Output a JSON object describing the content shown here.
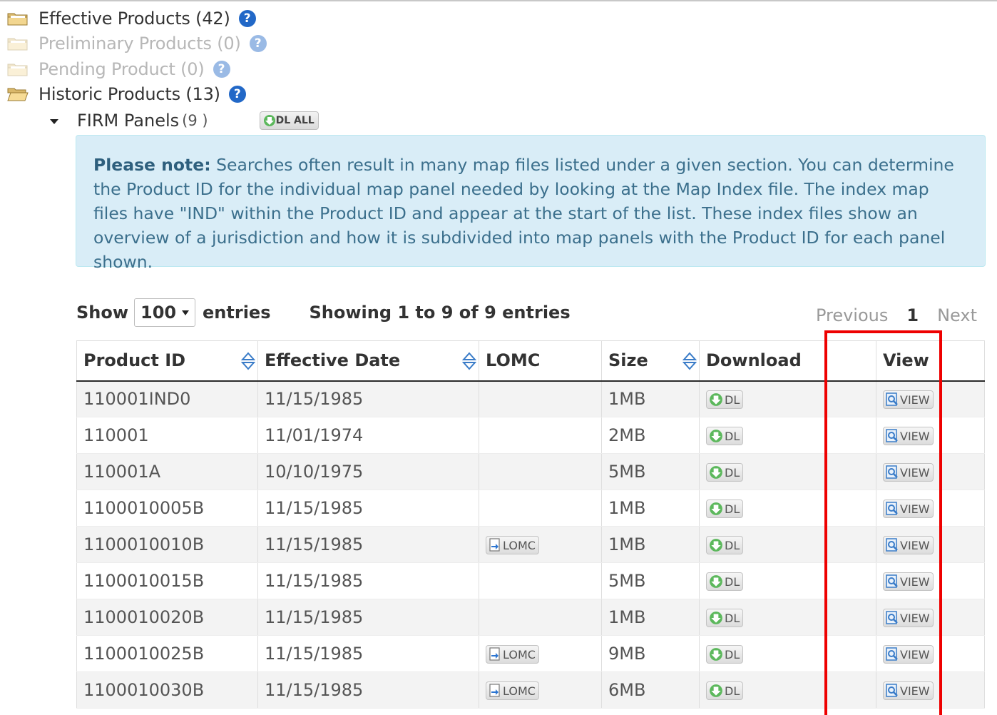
{
  "tree": {
    "items": [
      {
        "label": "Effective Products (42)",
        "disabled": false,
        "open": false
      },
      {
        "label": "Preliminary Products (0)",
        "disabled": true,
        "open": false
      },
      {
        "label": "Pending Product (0)",
        "disabled": true,
        "open": false
      },
      {
        "label": "Historic Products (13)",
        "disabled": false,
        "open": true
      }
    ],
    "help_glyph": "?"
  },
  "subsection": {
    "label": "FIRM Panels",
    "count": "(9 )",
    "dl_all_label": "DL ALL"
  },
  "note": {
    "lead": "Please note:",
    "text": " Searches often result in many map files listed under a given section. You can determine the Product ID for the individual map panel needed by looking at the Map Index file. The index map files have \"IND\" within the Product ID and appear at the start of the list. These index files show an overview of a jurisdiction and how it is subdivided into map panels with the Product ID for each panel shown."
  },
  "controls": {
    "show_label": "Show",
    "page_size": "100",
    "entries_label": "entries",
    "showing_text": "Showing 1 to 9 of 9 entries"
  },
  "pager": {
    "previous": "Previous",
    "current": "1",
    "next": "Next"
  },
  "table": {
    "headers": [
      "Product ID",
      "Effective Date",
      "LOMC",
      "Size",
      "Download",
      "",
      "View"
    ],
    "dl_label": "DL",
    "view_label": "VIEW",
    "lomc_label": "LOMC",
    "rows": [
      {
        "id": "110001IND0",
        "date": "11/15/1985",
        "lomc": false,
        "size": "1MB"
      },
      {
        "id": "110001",
        "date": "11/01/1974",
        "lomc": false,
        "size": "2MB"
      },
      {
        "id": "110001A",
        "date": "10/10/1975",
        "lomc": false,
        "size": "5MB"
      },
      {
        "id": "1100010005B",
        "date": "11/15/1985",
        "lomc": false,
        "size": "1MB"
      },
      {
        "id": "1100010010B",
        "date": "11/15/1985",
        "lomc": true,
        "size": "1MB"
      },
      {
        "id": "1100010015B",
        "date": "11/15/1985",
        "lomc": false,
        "size": "5MB"
      },
      {
        "id": "1100010020B",
        "date": "11/15/1985",
        "lomc": false,
        "size": "1MB"
      },
      {
        "id": "1100010025B",
        "date": "11/15/1985",
        "lomc": true,
        "size": "9MB"
      },
      {
        "id": "1100010030B",
        "date": "11/15/1985",
        "lomc": true,
        "size": "6MB"
      }
    ]
  },
  "colors": {
    "help": "#2268c7",
    "note_bg": "#d9edf7",
    "highlight": "#ee0000",
    "dl_icon": "#5cb85c",
    "view_icon": "#3a7cc8"
  },
  "icons": {
    "folder": "folder-icon",
    "help": "help-icon",
    "dl": "download-arrow-icon",
    "view": "magnifier-doc-icon",
    "lomc": "lomc-doc-icon",
    "sort": "sort-icon"
  }
}
